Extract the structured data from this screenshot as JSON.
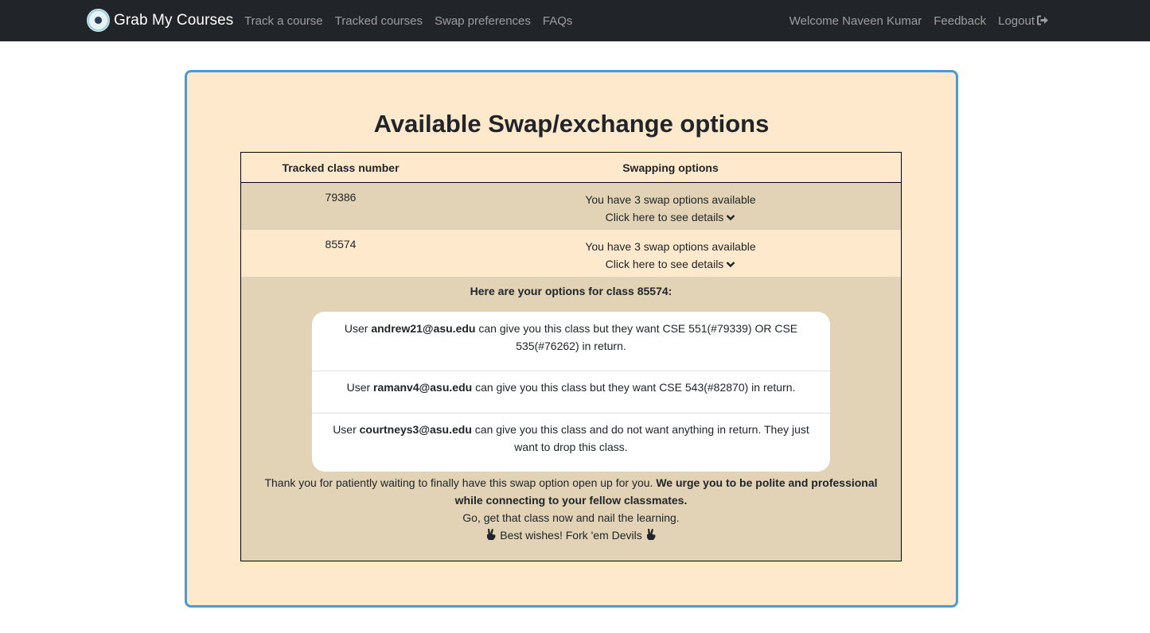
{
  "nav": {
    "brand": "Grab My Courses",
    "links": [
      "Track a course",
      "Tracked courses",
      "Swap preferences",
      "FAQs"
    ],
    "welcome": "Welcome Naveen Kumar",
    "feedback": "Feedback",
    "logout": "Logout"
  },
  "page": {
    "heading": "Available Swap/exchange options"
  },
  "table": {
    "headers": {
      "class_number": "Tracked class number",
      "swapping_options": "Swapping options"
    },
    "rows": [
      {
        "class_number": "79386",
        "options_text": "You have 3 swap options available",
        "details_link": "Click here to see details"
      },
      {
        "class_number": "85574",
        "options_text": "You have 3 swap options available",
        "details_link": "Click here to see details"
      }
    ]
  },
  "details": {
    "title": "Here are your options for class 85574:",
    "options": [
      {
        "prefix": "User",
        "user": "andrew21@asu.edu",
        "text": "can give you this class but they want CSE 551(#79339) OR CSE 535(#76262) in return."
      },
      {
        "prefix": "User",
        "user": "ramanv4@asu.edu",
        "text": "can give you this class but they want CSE 543(#82870) in return."
      },
      {
        "prefix": "User",
        "user": "courtneys3@asu.edu",
        "text": "can give you this class and do not want anything in return. They just want to drop this class."
      }
    ],
    "thanks": "Thank you for patiently waiting to finally have this swap option open up for you.",
    "urge": "We urge you to be polite and professional while connecting to your fellow classmates.",
    "go": "Go, get that class now and nail the learning.",
    "wishes": "Best wishes! Fork 'em Devils"
  },
  "icons": {
    "logo": "brand-logo-icon",
    "logout": "sign-out-icon",
    "details": "chevron-down-icon",
    "wishes": "hand-victory-icon"
  },
  "colors": {
    "navbar": "#212529",
    "card_background": "#ffe9cc",
    "card_border": "#4a9ad4",
    "row_shade": "#e2d3b6"
  }
}
